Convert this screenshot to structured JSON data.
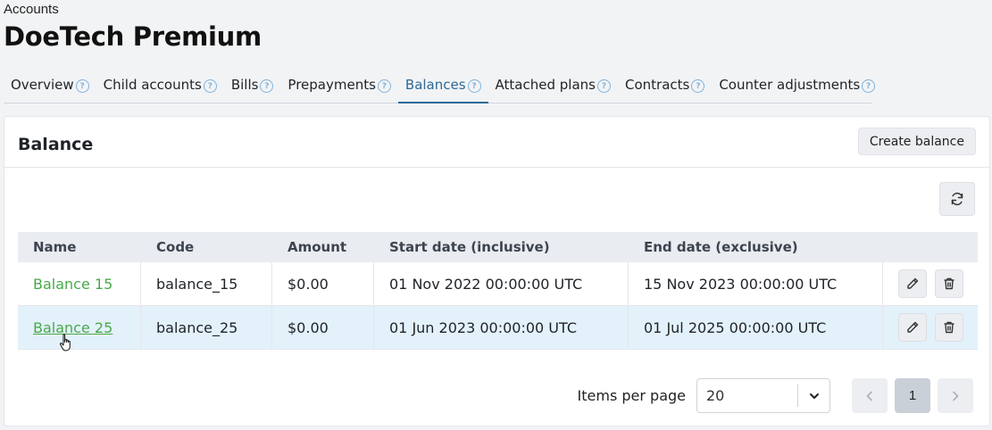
{
  "header": {
    "breadcrumb": "Accounts",
    "title": "DoeTech Premium"
  },
  "tabs": [
    {
      "label": "Overview",
      "active": false
    },
    {
      "label": "Child accounts",
      "active": false
    },
    {
      "label": "Bills",
      "active": false
    },
    {
      "label": "Prepayments",
      "active": false
    },
    {
      "label": "Balances",
      "active": true
    },
    {
      "label": "Attached plans",
      "active": false
    },
    {
      "label": "Contracts",
      "active": false
    },
    {
      "label": "Counter adjustments",
      "active": false
    }
  ],
  "card": {
    "title": "Balance",
    "create_label": "Create balance"
  },
  "table": {
    "columns": [
      "Name",
      "Code",
      "Amount",
      "Start date (inclusive)",
      "End date (exclusive)"
    ],
    "rows": [
      {
        "name": "Balance 15",
        "code": "balance_15",
        "amount": "$0.00",
        "start": "01 Nov 2022 00:00:00 UTC",
        "end": "15 Nov 2023 00:00:00 UTC"
      },
      {
        "name": "Balance 25",
        "code": "balance_25",
        "amount": "$0.00",
        "start": "01 Jun 2023 00:00:00 UTC",
        "end": "01 Jul 2025 00:00:00 UTC"
      }
    ]
  },
  "pagination": {
    "items_label": "Items per page",
    "per_page": "20",
    "current_page": "1"
  },
  "colors": {
    "accent": "#2d6a96",
    "link": "#4aa84a",
    "row_hover": "#e3f1fb"
  }
}
